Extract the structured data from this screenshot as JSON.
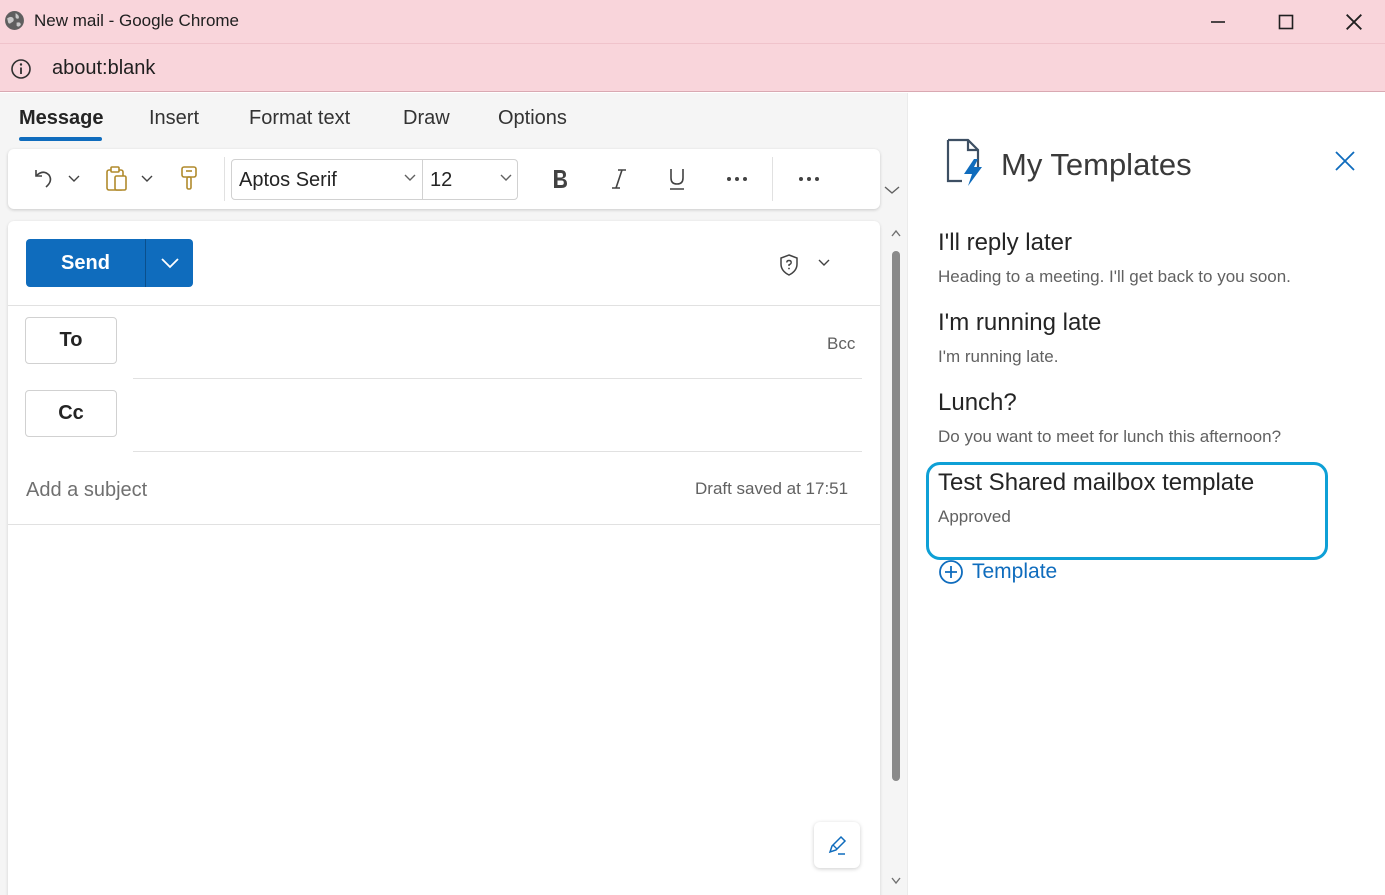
{
  "window": {
    "title": "New mail - Google Chrome",
    "url": "about:blank"
  },
  "tabs": [
    {
      "label": "Message",
      "active": true
    },
    {
      "label": "Insert",
      "active": false
    },
    {
      "label": "Format text",
      "active": false
    },
    {
      "label": "Draw",
      "active": false
    },
    {
      "label": "Options",
      "active": false
    }
  ],
  "ribbon": {
    "font_name": "Aptos Serif",
    "font_size": "12"
  },
  "compose": {
    "send_label": "Send",
    "to_label": "To",
    "cc_label": "Cc",
    "bcc_label": "Bcc",
    "subject_placeholder": "Add a subject",
    "draft_status": "Draft saved at 17:51"
  },
  "templates_pane": {
    "title": "My Templates",
    "templates": [
      {
        "name": "I'll reply later",
        "body": "Heading to a meeting. I'll get back to you soon."
      },
      {
        "name": "I'm running late",
        "body": "I'm running late."
      },
      {
        "name": "Lunch?",
        "body": "Do you want to meet for lunch this afternoon?"
      },
      {
        "name": "Test Shared mailbox template",
        "body": "Approved",
        "highlighted": true
      }
    ],
    "add_label": "Template"
  },
  "colors": {
    "titlebar": "#f9d5db",
    "accent": "#0f6cbd",
    "highlight": "#0ea0d6"
  },
  "icons": [
    "globe-icon",
    "minimize-icon",
    "maximize-icon",
    "close-icon",
    "info-icon",
    "undo-icon",
    "clipboard-icon",
    "format-painter-icon",
    "bold-icon",
    "italic-icon",
    "underline-icon",
    "more-icon",
    "shield-icon",
    "pen-icon",
    "templates-icon",
    "plus-circle-icon"
  ]
}
